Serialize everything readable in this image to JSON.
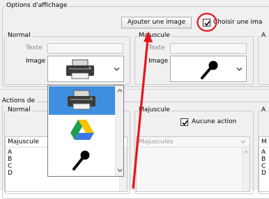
{
  "options_group": {
    "legend": "Options d'affichage",
    "add_image_button": "Ajouter une image",
    "choose_image_checkbox": {
      "label": "Choisir une ima",
      "checked": true
    }
  },
  "normal_panel": {
    "legend": "Normal",
    "text_label": "Texte",
    "image_label": "Image",
    "image_value_icon": "printer-icon"
  },
  "majuscule_panel": {
    "legend": "Majuscule",
    "text_label": "Texte",
    "image_label": "Image",
    "image_value_icon": "microphone-icon"
  },
  "third_panel": {
    "legend": "A"
  },
  "image_dropdown": {
    "options": [
      {
        "icon": "printer-icon",
        "selected": true
      },
      {
        "icon": "google-drive-icon",
        "selected": false
      },
      {
        "icon": "microphone-icon",
        "selected": false
      }
    ]
  },
  "actions_group": {
    "legend": "Actions de",
    "normal": {
      "legend": "Normal",
      "list_header": "Majuscule",
      "items": [
        "A",
        "B",
        "C",
        "D"
      ]
    },
    "majuscule": {
      "legend": "Majuscule",
      "no_action_checkbox": {
        "label": "Aucune action",
        "checked": true
      },
      "list_header": "Majuscules",
      "items": []
    },
    "third": {
      "legend": "A",
      "list_header": "M",
      "items": [
        "A",
        "B",
        "C",
        "D"
      ]
    }
  },
  "annotations": {
    "circle_color": "#e8141b",
    "arrow_color": "#e8141b"
  }
}
